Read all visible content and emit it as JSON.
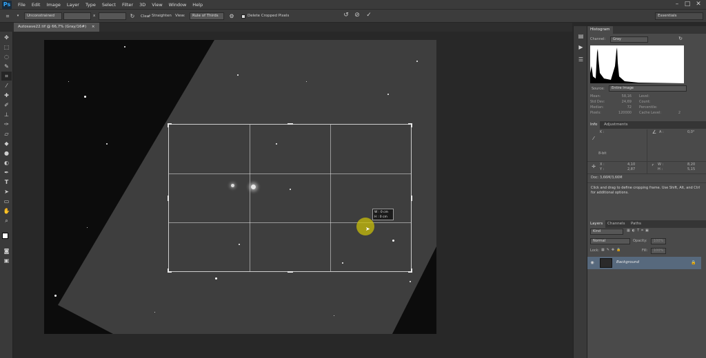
{
  "menu": {
    "logo": "Ps",
    "items": [
      "File",
      "Edit",
      "Image",
      "Layer",
      "Type",
      "Select",
      "Filter",
      "3D",
      "View",
      "Window",
      "Help"
    ]
  },
  "window_controls": [
    "–",
    "□",
    "✕"
  ],
  "options": {
    "ratio": "Unconstrained",
    "x_sep": "x",
    "clear": "Clear",
    "straighten": "Straighten",
    "view_label": "View:",
    "view_value": "Rule of Thirds",
    "delete_cropped": "Delete Cropped Pixels",
    "workspace": "Essentials"
  },
  "document": {
    "tab_title": "Autosave22.tif @ 66,7% (Gray/16#)",
    "tab_close": "×"
  },
  "tooltip": {
    "w": "W : 0 cm",
    "h": "H : 0 cm"
  },
  "histogram": {
    "tab": "Histogram",
    "channel_label": "Channel:",
    "channel_value": "Gray",
    "source_label": "Source:",
    "source_value": "Entire Image",
    "stats": [
      {
        "label": "Mean:",
        "value": "58,16"
      },
      {
        "label": "Std Dev:",
        "value": "24,69"
      },
      {
        "label": "Median:",
        "value": "72"
      },
      {
        "label": "Pixels:",
        "value": "120000"
      }
    ],
    "stats_right": [
      {
        "label": "Level:",
        "value": ""
      },
      {
        "label": "Count:",
        "value": ""
      },
      {
        "label": "Percentile:",
        "value": ""
      },
      {
        "label": "Cache Level:",
        "value": "2"
      }
    ]
  },
  "info": {
    "tabs": [
      "Info",
      "Adjustments"
    ],
    "k_label": "K :",
    "a_label": "A :",
    "a_value": "0,0°",
    "bit": "8-bit",
    "x_label": "X :",
    "x_value": "4,10",
    "y_label": "Y :",
    "y_value": "2,87",
    "w_label": "W :",
    "w_value": "8,20",
    "h_label": "H :",
    "h_value": "5,15",
    "doc": "Doc: 3,66M/3,66M",
    "hint": "Click and drag to define cropping frame. Use Shift, Alt, and Ctrl for additional options."
  },
  "layers": {
    "tabs": [
      "Layers",
      "Channels",
      "Paths"
    ],
    "kind": "Kind",
    "blend": "Normal",
    "opacity_label": "Opacity:",
    "opacity_value": "100%",
    "lock_label": "Lock:",
    "fill_label": "Fill:",
    "fill_value": "100%",
    "layer_name": "Background"
  }
}
